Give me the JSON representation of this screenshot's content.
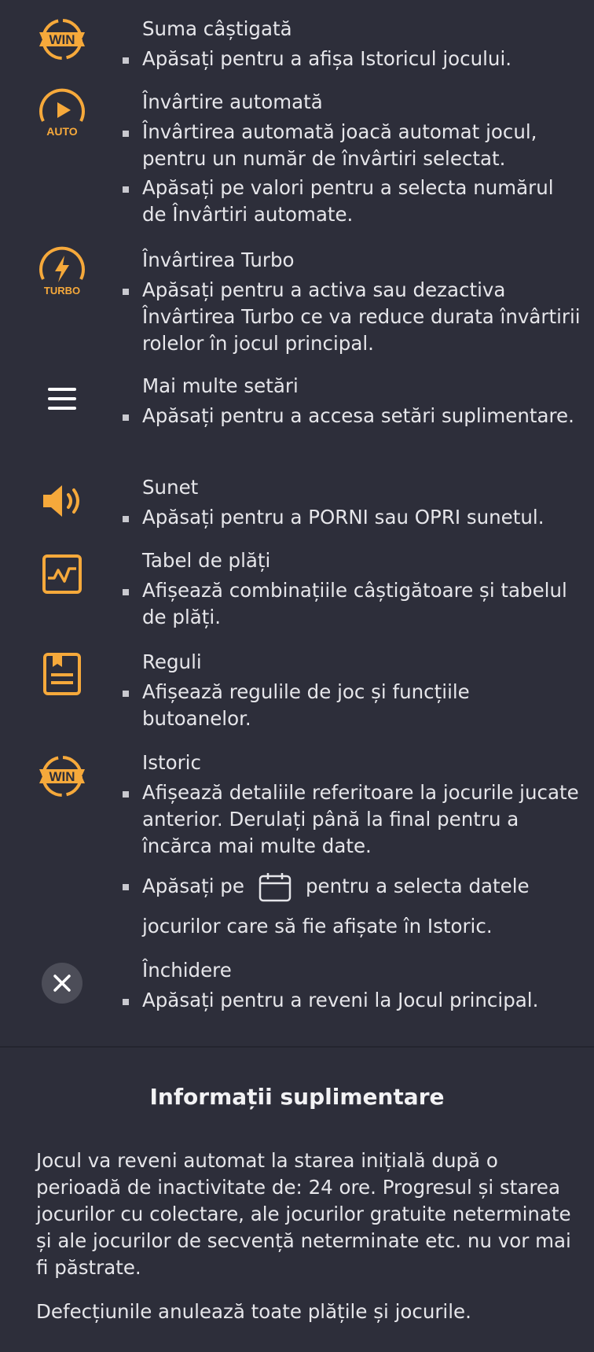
{
  "colors": {
    "background": "#2d2e3a",
    "accent": "#f6a93b",
    "text": "#e6e6ea"
  },
  "items": [
    {
      "icon": "win-badge-icon",
      "title": "Suma câștigată",
      "bullets": [
        "Apăsați pentru a afișa Istoricul jocului."
      ]
    },
    {
      "icon": "auto-spin-icon",
      "title": "Învârtire automată",
      "bullets": [
        "Învârtirea automată joacă automat jocul, pentru un număr de învârtiri selectat.",
        "Apăsați pe valori pentru a selecta numărul de Învârtiri automate."
      ]
    },
    {
      "icon": "turbo-icon",
      "title": "Învârtirea Turbo",
      "bullets": [
        "Apăsați pentru a activa sau dezactiva Învârtirea Turbo ce va reduce durata învârtirii rolelor în jocul principal."
      ]
    },
    {
      "icon": "menu-icon",
      "title": "Mai multe setări",
      "bullets": [
        "Apăsați pentru a accesa setări suplimentare."
      ]
    },
    {
      "icon": "sound-icon",
      "title": "Sunet",
      "bullets": [
        "Apăsați pentru a PORNI sau OPRI sunetul."
      ]
    },
    {
      "icon": "paytable-icon",
      "title": "Tabel de plăți",
      "bullets": [
        "Afișează combinațiile câștigătoare și tabelul de plăți."
      ]
    },
    {
      "icon": "rules-icon",
      "title": "Reguli",
      "bullets": [
        "Afișează regulile de joc și funcțiile butoanelor."
      ]
    },
    {
      "icon": "history-icon",
      "title": "Istoric",
      "bullets": [
        "Afișează detaliile referitoare la jocurile jucate anterior. Derulați până la final pentru a încărca mai multe date."
      ],
      "bullet2_a": "Apăsați pe",
      "bullet2_b": "pentru a selecta datele",
      "bullet2_c": "jocurilor care să fie afișate în Istoric."
    },
    {
      "icon": "close-icon",
      "title": "Închidere",
      "bullets": [
        "Apăsați pentru a reveni la Jocul principal."
      ]
    }
  ],
  "icon_text": {
    "win": "WIN",
    "auto": "AUTO",
    "turbo": "TURBO"
  },
  "extra": {
    "title": "Informații suplimentare",
    "p1": "Jocul va reveni automat la starea inițială după o perioadă de inactivitate de: 24 ore. Progresul și starea jocurilor cu colectare, ale jocurilor gratuite neterminate și ale jocurilor de secvență neterminate etc. nu vor mai fi păstrate.",
    "p2": "Defecțiunile anulează toate plățile și jocurile."
  }
}
